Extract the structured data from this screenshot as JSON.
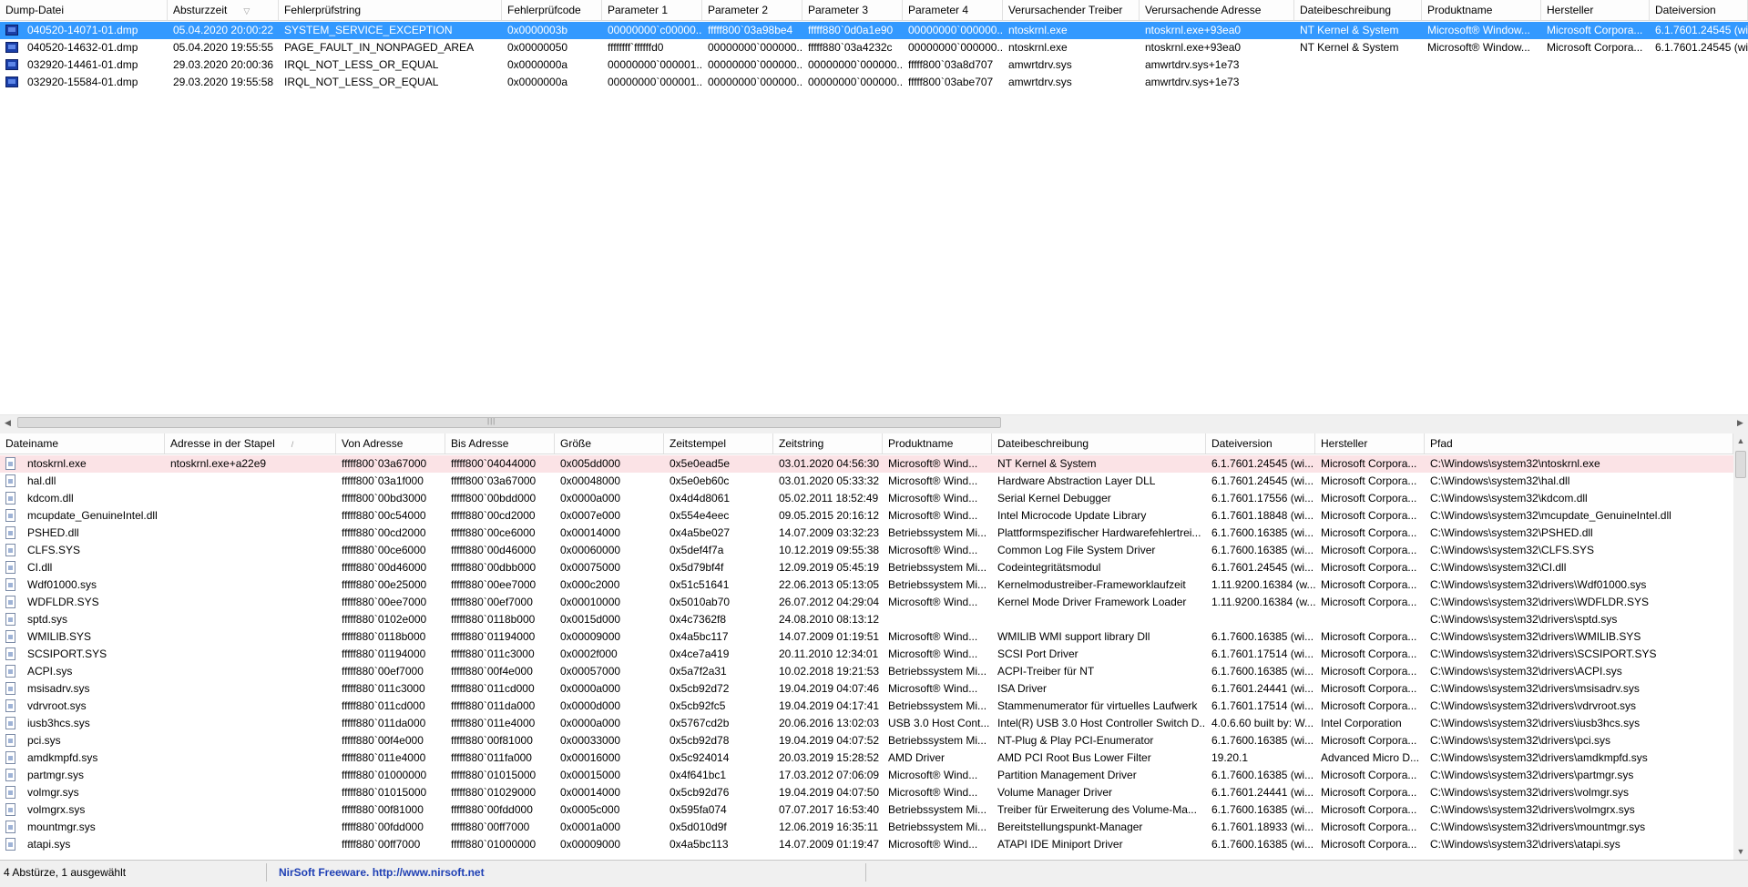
{
  "dumps": {
    "columns": [
      {
        "label": "Dump-Datei",
        "w": 184
      },
      {
        "label": "Absturzzeit",
        "w": 122,
        "sorted": true
      },
      {
        "label": "Fehlerprüfstring",
        "w": 245
      },
      {
        "label": "Fehlerprüfcode",
        "w": 110
      },
      {
        "label": "Parameter 1",
        "w": 110
      },
      {
        "label": "Parameter 2",
        "w": 110
      },
      {
        "label": "Parameter 3",
        "w": 110
      },
      {
        "label": "Parameter 4",
        "w": 110
      },
      {
        "label": "Verursachender Treiber",
        "w": 150
      },
      {
        "label": "Verursachende Adresse",
        "w": 170
      },
      {
        "label": "Dateibeschreibung",
        "w": 140
      },
      {
        "label": "Produktname",
        "w": 131
      },
      {
        "label": "Hersteller",
        "w": 119
      },
      {
        "label": "Dateiversion",
        "w": 108
      }
    ],
    "sort_indicator": "▽",
    "rows": [
      {
        "selected": true,
        "cells": [
          "040520-14071-01.dmp",
          "05.04.2020 20:00:22",
          "SYSTEM_SERVICE_EXCEPTION",
          "0x0000003b",
          "00000000`c00000...",
          "fffff800`03a98be4",
          "fffff880`0d0a1e90",
          "00000000`000000...",
          "ntoskrnl.exe",
          "ntoskrnl.exe+93ea0",
          "NT Kernel & System",
          "Microsoft® Window...",
          "Microsoft Corpora...",
          "6.1.7601.24545 (wi..."
        ]
      },
      {
        "selected": false,
        "cells": [
          "040520-14632-01.dmp",
          "05.04.2020 19:55:55",
          "PAGE_FAULT_IN_NONPAGED_AREA",
          "0x00000050",
          "ffffffff`ffffffd0",
          "00000000`000000...",
          "fffff880`03a4232c",
          "00000000`000000...",
          "ntoskrnl.exe",
          "ntoskrnl.exe+93ea0",
          "NT Kernel & System",
          "Microsoft® Window...",
          "Microsoft Corpora...",
          "6.1.7601.24545 (wi..."
        ]
      },
      {
        "selected": false,
        "cells": [
          "032920-14461-01.dmp",
          "29.03.2020 20:00:36",
          "IRQL_NOT_LESS_OR_EQUAL",
          "0x0000000a",
          "00000000`000001...",
          "00000000`000000...",
          "00000000`000000...",
          "fffff800`03a8d707",
          "amwrtdrv.sys",
          "amwrtdrv.sys+1e73",
          "",
          "",
          "",
          ""
        ]
      },
      {
        "selected": false,
        "cells": [
          "032920-15584-01.dmp",
          "29.03.2020 19:55:58",
          "IRQL_NOT_LESS_OR_EQUAL",
          "0x0000000a",
          "00000000`000001...",
          "00000000`000000...",
          "00000000`000000...",
          "fffff800`03abe707",
          "amwrtdrv.sys",
          "amwrtdrv.sys+1e73",
          "",
          "",
          "",
          ""
        ]
      }
    ]
  },
  "modules": {
    "columns": [
      {
        "label": "Dateiname",
        "w": 181
      },
      {
        "label": "Adresse in der Stapel",
        "w": 188,
        "sorted": true
      },
      {
        "label": "Von Adresse",
        "w": 120
      },
      {
        "label": "Bis Adresse",
        "w": 120
      },
      {
        "label": "Größe",
        "w": 120
      },
      {
        "label": "Zeitstempel",
        "w": 120
      },
      {
        "label": "Zeitstring",
        "w": 120
      },
      {
        "label": "Produktname",
        "w": 120
      },
      {
        "label": "Dateibeschreibung",
        "w": 235
      },
      {
        "label": "Dateiversion",
        "w": 120
      },
      {
        "label": "Hersteller",
        "w": 120
      },
      {
        "label": "Pfad",
        "w": 339
      }
    ],
    "sort_indicator": "/",
    "rows": [
      {
        "hl": true,
        "cells": [
          "ntoskrnl.exe",
          "ntoskrnl.exe+a22e9",
          "fffff800`03a67000",
          "fffff800`04044000",
          "0x005dd000",
          "0x5e0ead5e",
          "03.01.2020 04:56:30",
          "Microsoft® Wind...",
          "NT Kernel & System",
          "6.1.7601.24545 (wi...",
          "Microsoft Corpora...",
          "C:\\Windows\\system32\\ntoskrnl.exe"
        ]
      },
      {
        "cells": [
          "hal.dll",
          "",
          "fffff800`03a1f000",
          "fffff800`03a67000",
          "0x00048000",
          "0x5e0eb60c",
          "03.01.2020 05:33:32",
          "Microsoft® Wind...",
          "Hardware Abstraction Layer DLL",
          "6.1.7601.24545 (wi...",
          "Microsoft Corpora...",
          "C:\\Windows\\system32\\hal.dll"
        ]
      },
      {
        "cells": [
          "kdcom.dll",
          "",
          "fffff800`00bd3000",
          "fffff800`00bdd000",
          "0x0000a000",
          "0x4d4d8061",
          "05.02.2011 18:52:49",
          "Microsoft® Wind...",
          "Serial Kernel Debugger",
          "6.1.7601.17556 (wi...",
          "Microsoft Corpora...",
          "C:\\Windows\\system32\\kdcom.dll"
        ]
      },
      {
        "cells": [
          "mcupdate_GenuineIntel.dll",
          "",
          "fffff880`00c54000",
          "fffff880`00cd2000",
          "0x0007e000",
          "0x554e4eec",
          "09.05.2015 20:16:12",
          "Microsoft® Wind...",
          "Intel Microcode Update Library",
          "6.1.7601.18848 (wi...",
          "Microsoft Corpora...",
          "C:\\Windows\\system32\\mcupdate_GenuineIntel.dll"
        ]
      },
      {
        "cells": [
          "PSHED.dll",
          "",
          "fffff880`00cd2000",
          "fffff880`00ce6000",
          "0x00014000",
          "0x4a5be027",
          "14.07.2009 03:32:23",
          "Betriebssystem Mi...",
          "Plattformspezifischer Hardwarefehlertrei...",
          "6.1.7600.16385 (wi...",
          "Microsoft Corpora...",
          "C:\\Windows\\system32\\PSHED.dll"
        ]
      },
      {
        "cells": [
          "CLFS.SYS",
          "",
          "fffff880`00ce6000",
          "fffff880`00d46000",
          "0x00060000",
          "0x5def4f7a",
          "10.12.2019 09:55:38",
          "Microsoft® Wind...",
          "Common Log File System Driver",
          "6.1.7600.16385 (wi...",
          "Microsoft Corpora...",
          "C:\\Windows\\system32\\CLFS.SYS"
        ]
      },
      {
        "cells": [
          "CI.dll",
          "",
          "fffff880`00d46000",
          "fffff880`00dbb000",
          "0x00075000",
          "0x5d79bf4f",
          "12.09.2019 05:45:19",
          "Betriebssystem Mi...",
          "Codeintegritätsmodul",
          "6.1.7601.24545 (wi...",
          "Microsoft Corpora...",
          "C:\\Windows\\system32\\CI.dll"
        ]
      },
      {
        "cells": [
          "Wdf01000.sys",
          "",
          "fffff880`00e25000",
          "fffff880`00ee7000",
          "0x000c2000",
          "0x51c51641",
          "22.06.2013 05:13:05",
          "Betriebssystem Mi...",
          "Kernelmodustreiber-Frameworklaufzeit",
          "1.11.9200.16384 (w...",
          "Microsoft Corpora...",
          "C:\\Windows\\system32\\drivers\\Wdf01000.sys"
        ]
      },
      {
        "cells": [
          "WDFLDR.SYS",
          "",
          "fffff880`00ee7000",
          "fffff880`00ef7000",
          "0x00010000",
          "0x5010ab70",
          "26.07.2012 04:29:04",
          "Microsoft® Wind...",
          "Kernel Mode Driver Framework Loader",
          "1.11.9200.16384 (w...",
          "Microsoft Corpora...",
          "C:\\Windows\\system32\\drivers\\WDFLDR.SYS"
        ]
      },
      {
        "cells": [
          "sptd.sys",
          "",
          "fffff880`0102e000",
          "fffff880`0118b000",
          "0x0015d000",
          "0x4c7362f8",
          "24.08.2010 08:13:12",
          "",
          "",
          "",
          "",
          "C:\\Windows\\system32\\drivers\\sptd.sys"
        ]
      },
      {
        "cells": [
          "WMILIB.SYS",
          "",
          "fffff880`0118b000",
          "fffff880`01194000",
          "0x00009000",
          "0x4a5bc117",
          "14.07.2009 01:19:51",
          "Microsoft® Wind...",
          "WMILIB WMI support library Dll",
          "6.1.7600.16385 (wi...",
          "Microsoft Corpora...",
          "C:\\Windows\\system32\\drivers\\WMILIB.SYS"
        ]
      },
      {
        "cells": [
          "SCSIPORT.SYS",
          "",
          "fffff880`01194000",
          "fffff880`011c3000",
          "0x0002f000",
          "0x4ce7a419",
          "20.11.2010 12:34:01",
          "Microsoft® Wind...",
          "SCSI Port Driver",
          "6.1.7601.17514 (wi...",
          "Microsoft Corpora...",
          "C:\\Windows\\system32\\drivers\\SCSIPORT.SYS"
        ]
      },
      {
        "cells": [
          "ACPI.sys",
          "",
          "fffff880`00ef7000",
          "fffff880`00f4e000",
          "0x00057000",
          "0x5a7f2a31",
          "10.02.2018 19:21:53",
          "Betriebssystem Mi...",
          "ACPI-Treiber für NT",
          "6.1.7600.16385 (wi...",
          "Microsoft Corpora...",
          "C:\\Windows\\system32\\drivers\\ACPI.sys"
        ]
      },
      {
        "cells": [
          "msisadrv.sys",
          "",
          "fffff880`011c3000",
          "fffff880`011cd000",
          "0x0000a000",
          "0x5cb92d72",
          "19.04.2019 04:07:46",
          "Microsoft® Wind...",
          "ISA Driver",
          "6.1.7601.24441 (wi...",
          "Microsoft Corpora...",
          "C:\\Windows\\system32\\drivers\\msisadrv.sys"
        ]
      },
      {
        "cells": [
          "vdrvroot.sys",
          "",
          "fffff880`011cd000",
          "fffff880`011da000",
          "0x0000d000",
          "0x5cb92fc5",
          "19.04.2019 04:17:41",
          "Betriebssystem Mi...",
          "Stammenumerator für virtuelles Laufwerk",
          "6.1.7601.17514 (wi...",
          "Microsoft Corpora...",
          "C:\\Windows\\system32\\drivers\\vdrvroot.sys"
        ]
      },
      {
        "cells": [
          "iusb3hcs.sys",
          "",
          "fffff880`011da000",
          "fffff880`011e4000",
          "0x0000a000",
          "0x5767cd2b",
          "20.06.2016 13:02:03",
          "USB 3.0 Host Cont...",
          "Intel(R) USB 3.0 Host Controller Switch D...",
          "4.0.6.60 built by: W...",
          "Intel Corporation",
          "C:\\Windows\\system32\\drivers\\iusb3hcs.sys"
        ]
      },
      {
        "cells": [
          "pci.sys",
          "",
          "fffff880`00f4e000",
          "fffff880`00f81000",
          "0x00033000",
          "0x5cb92d78",
          "19.04.2019 04:07:52",
          "Betriebssystem Mi...",
          "NT-Plug & Play PCI-Enumerator",
          "6.1.7600.16385 (wi...",
          "Microsoft Corpora...",
          "C:\\Windows\\system32\\drivers\\pci.sys"
        ]
      },
      {
        "cells": [
          "amdkmpfd.sys",
          "",
          "fffff880`011e4000",
          "fffff880`011fa000",
          "0x00016000",
          "0x5c924014",
          "20.03.2019 15:28:52",
          "AMD Driver",
          "AMD PCI Root Bus Lower Filter",
          "19.20.1",
          "Advanced Micro D...",
          "C:\\Windows\\system32\\drivers\\amdkmpfd.sys"
        ]
      },
      {
        "cells": [
          "partmgr.sys",
          "",
          "fffff880`01000000",
          "fffff880`01015000",
          "0x00015000",
          "0x4f641bc1",
          "17.03.2012 07:06:09",
          "Microsoft® Wind...",
          "Partition Management Driver",
          "6.1.7600.16385 (wi...",
          "Microsoft Corpora...",
          "C:\\Windows\\system32\\drivers\\partmgr.sys"
        ]
      },
      {
        "cells": [
          "volmgr.sys",
          "",
          "fffff880`01015000",
          "fffff880`01029000",
          "0x00014000",
          "0x5cb92d76",
          "19.04.2019 04:07:50",
          "Microsoft® Wind...",
          "Volume Manager Driver",
          "6.1.7601.24441 (wi...",
          "Microsoft Corpora...",
          "C:\\Windows\\system32\\drivers\\volmgr.sys"
        ]
      },
      {
        "cells": [
          "volmgrx.sys",
          "",
          "fffff880`00f81000",
          "fffff880`00fdd000",
          "0x0005c000",
          "0x595fa074",
          "07.07.2017 16:53:40",
          "Betriebssystem Mi...",
          "Treiber für Erweiterung des Volume-Ma...",
          "6.1.7600.16385 (wi...",
          "Microsoft Corpora...",
          "C:\\Windows\\system32\\drivers\\volmgrx.sys"
        ]
      },
      {
        "cells": [
          "mountmgr.sys",
          "",
          "fffff880`00fdd000",
          "fffff880`00ff7000",
          "0x0001a000",
          "0x5d010d9f",
          "12.06.2019 16:35:11",
          "Betriebssystem Mi...",
          "Bereitstellungspunkt-Manager",
          "6.1.7601.18933 (wi...",
          "Microsoft Corpora...",
          "C:\\Windows\\system32\\drivers\\mountmgr.sys"
        ]
      },
      {
        "cells": [
          "atapi.sys",
          "",
          "fffff880`00ff7000",
          "fffff880`01000000",
          "0x00009000",
          "0x4a5bc113",
          "14.07.2009 01:19:47",
          "Microsoft® Wind...",
          "ATAPI IDE Miniport Driver",
          "6.1.7600.16385 (wi...",
          "Microsoft Corpora...",
          "C:\\Windows\\system32\\drivers\\atapi.sys"
        ]
      }
    ]
  },
  "status": {
    "count_text": "4 Abstürze, 1 ausgewählt",
    "brand_text": "NirSoft Freeware.  http://www.nirsoft.net"
  },
  "scrollbar": {
    "left_arrow": "◀",
    "right_arrow": "▶",
    "up_arrow": "▲",
    "down_arrow": "▼",
    "grip": "|||"
  }
}
